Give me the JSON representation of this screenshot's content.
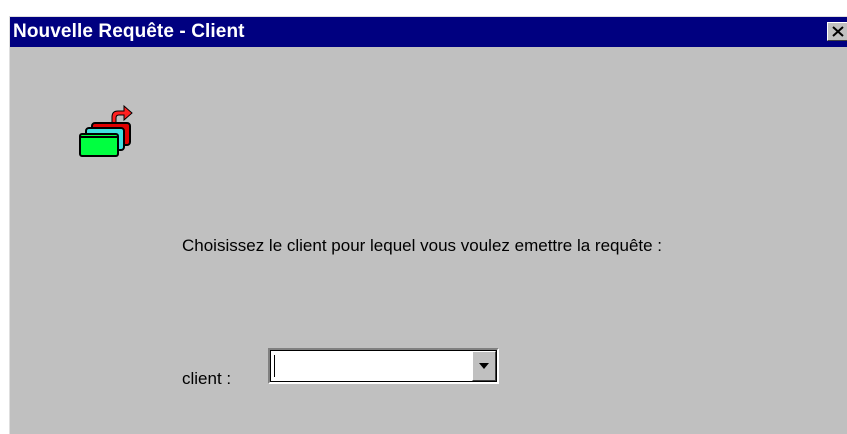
{
  "window": {
    "title": "Nouvelle Requête - Client",
    "close_icon": "close-icon"
  },
  "app_icon": "new-request-icon",
  "prompt": {
    "text": "Choisissez le client pour lequel vous voulez emettre la requête :"
  },
  "client_field": {
    "label": "client :",
    "value": "",
    "dropdown_icon": "chevron-down-icon"
  },
  "colors": {
    "titlebar": "#000080",
    "titlebar_text": "#ffffff",
    "dialog_background": "#c0c0c0",
    "icon_green": "#00ff40",
    "icon_red": "#e00000",
    "icon_cyan": "#40e0e0",
    "icon_arrow": "#ff2020"
  }
}
